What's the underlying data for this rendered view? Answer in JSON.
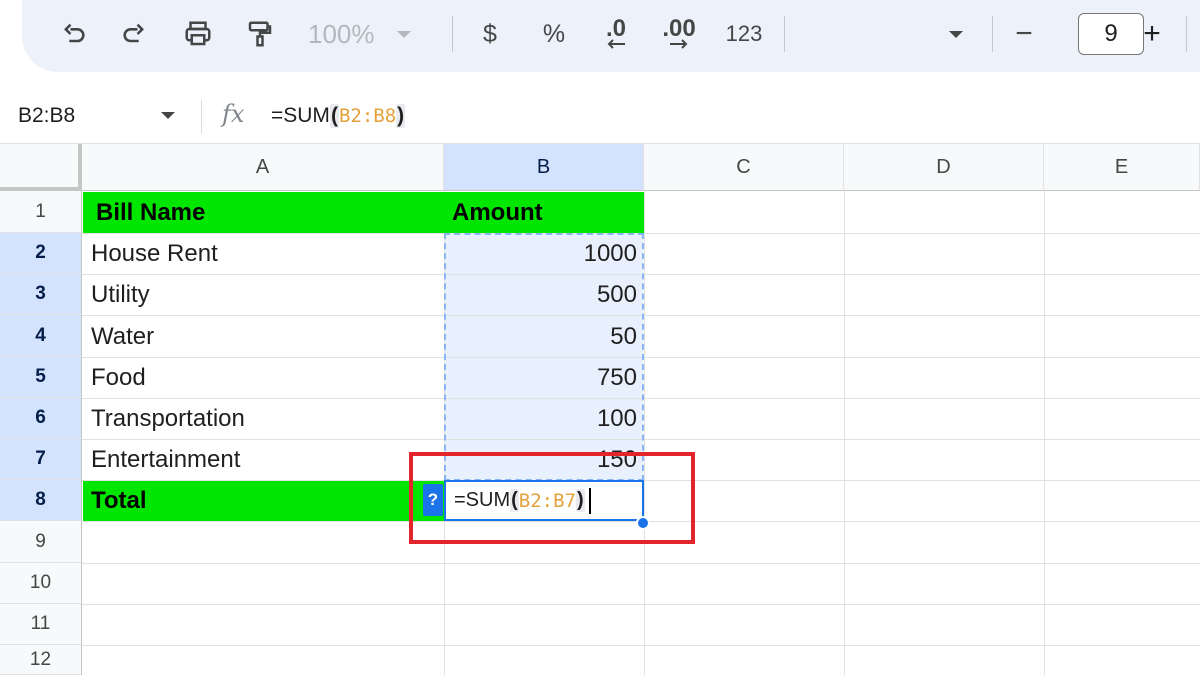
{
  "toolbar": {
    "zoom": "100%",
    "currency": "$",
    "percent": "%",
    "decrease_decimal": ".0",
    "increase_decimal": ".00",
    "number_format": "123",
    "font_size": "9",
    "minus": "−",
    "plus": "+"
  },
  "formula_bar": {
    "name_box": "B2:B8",
    "fx": "fx",
    "formula_func": "=SUM",
    "formula_open": "(",
    "formula_ref": "B2:B8",
    "formula_close": ")"
  },
  "columns": [
    "A",
    "B",
    "C",
    "D",
    "E"
  ],
  "rows": [
    "1",
    "2",
    "3",
    "4",
    "5",
    "6",
    "7",
    "8",
    "9",
    "10",
    "11",
    "12"
  ],
  "table": {
    "header": {
      "name": "Bill Name",
      "amount": "Amount"
    },
    "items": [
      {
        "name": "House Rent",
        "amount": "1000"
      },
      {
        "name": "Utility",
        "amount": "500"
      },
      {
        "name": "Water",
        "amount": "50"
      },
      {
        "name": "Food",
        "amount": "750"
      },
      {
        "name": "Transportation",
        "amount": "100"
      },
      {
        "name": "Entertainment",
        "amount": "150"
      }
    ],
    "total_label": "Total"
  },
  "editing": {
    "help": "?",
    "func": "=SUM",
    "open": "(",
    "ref": "B2:B7",
    "close": ")"
  },
  "colors": {
    "header_fill": "#00e600",
    "selection": "#d3e3fd",
    "range_fill": "#e8f0fe",
    "accent": "#1a73e8",
    "highlight": "#e3242b",
    "reference": "#e3a23b"
  }
}
